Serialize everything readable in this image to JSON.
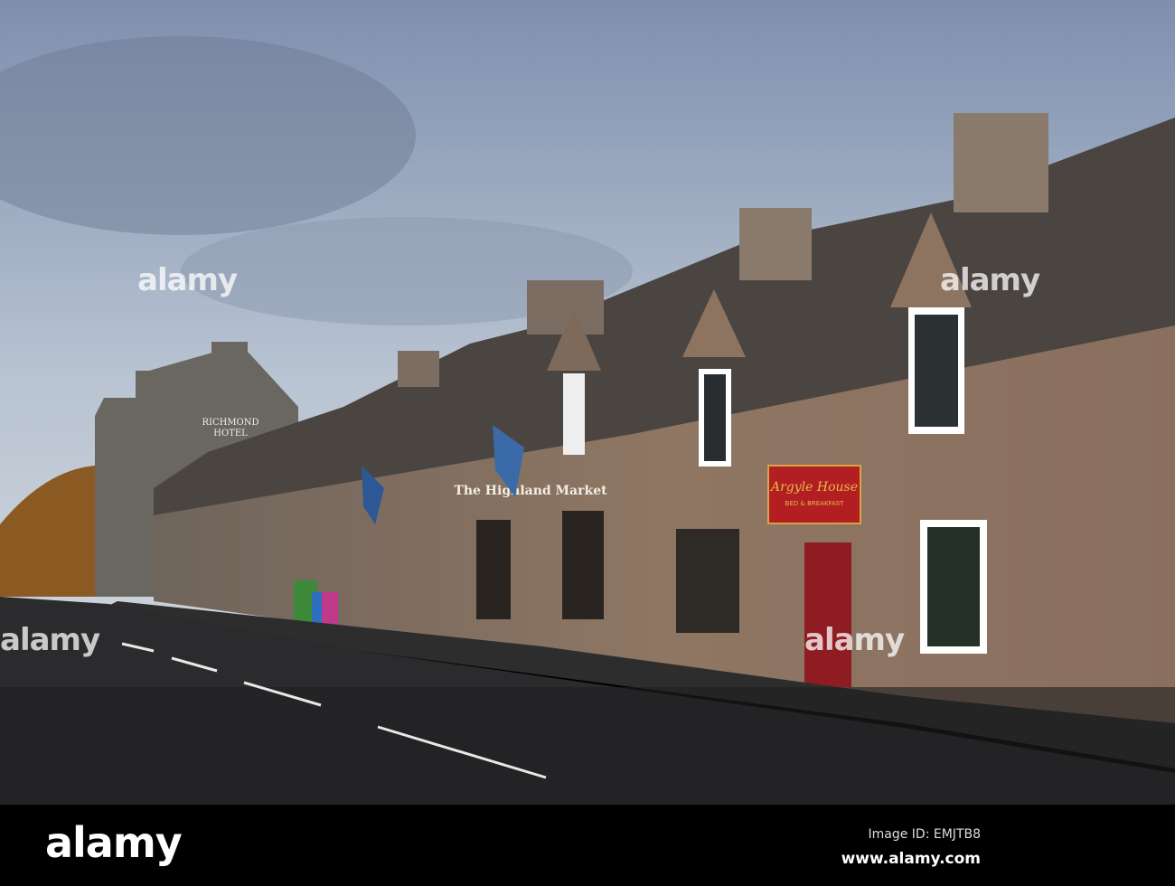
{
  "photo": {
    "hotel_sign": [
      "RICHMOND",
      "HOTEL"
    ],
    "market_sign": "The Highland Market",
    "bnb_sign": {
      "name": "Argyle House",
      "subtitle": "BED & BREAKFAST"
    },
    "colors": {
      "sky_top": "#8c9bb5",
      "sky_bottom": "#c5cfd9",
      "stone": "#8a7462",
      "roof": "#4a4440",
      "road": "#2a2a2c",
      "sign_red": "#b21e22"
    }
  },
  "watermark": {
    "text": "alamy"
  },
  "footer": {
    "logo": "alamy",
    "image_id": "Image ID: EMJTB8",
    "website": "www.alamy.com"
  }
}
